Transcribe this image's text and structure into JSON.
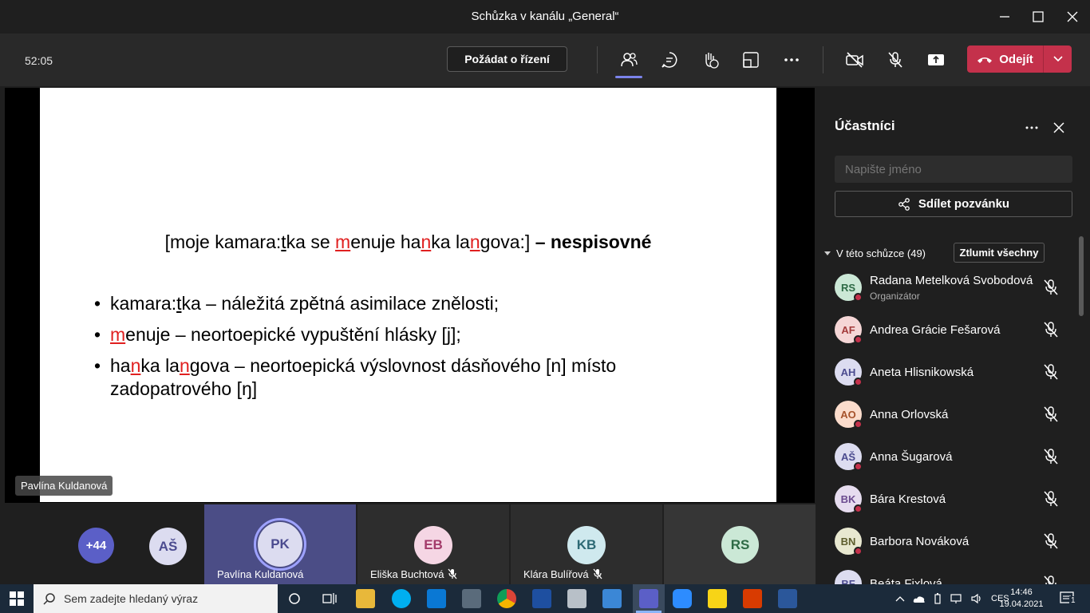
{
  "window": {
    "title": "Schůzka v kanálu „General“"
  },
  "toolbar": {
    "timer": "52:05",
    "request_control_label": "Požádat o řízení",
    "leave_label": "Odejít"
  },
  "slide": {
    "title_part1": "[moje kamara:",
    "title_t": "t",
    "title_part2": "ka se ",
    "title_m": "m",
    "title_part3": "enuje ha",
    "title_n1": "n",
    "title_part4": "ka la",
    "title_n2": "n",
    "title_part5": "gova:] ",
    "title_bold": "– nespisovné",
    "b1_a": "kamara:",
    "b1_t": "t",
    "b1_b": "ka – náležitá zpětná asimilace znělosti;",
    "b2_m": "m",
    "b2_b": "enuje – neortoepické vypuštění hlásky [j];",
    "b3_a": "ha",
    "b3_n1": "n",
    "b3_b": "ka la",
    "b3_n2": "n",
    "b3_c": "gova – neortoepická výslovnost dásňového [n] místo zadopatrového [ŋ]"
  },
  "stage": {
    "presenter_name": "Pavlína Kuldanová"
  },
  "strip": {
    "overflow_count": "+44",
    "tiles": [
      {
        "initials": "AŠ",
        "name": ""
      },
      {
        "initials": "PK",
        "name": "Pavlína Kuldanová"
      },
      {
        "initials": "EB",
        "name": "Eliška Buchtová"
      },
      {
        "initials": "KB",
        "name": "Klára Bulířová"
      },
      {
        "initials": "RS",
        "name": ""
      }
    ]
  },
  "panel": {
    "title": "Účastníci",
    "search_placeholder": "Napište jméno",
    "share_label": "Sdílet pozvánku",
    "section_label": "V této schůzce (49)",
    "mute_all_label": "Ztlumit všechny",
    "participants": [
      {
        "initials": "RS",
        "name": "Radana Metelková Svobodová",
        "role": "Organizátor",
        "color": "#cbe8d6",
        "text": "#2d6a45"
      },
      {
        "initials": "AF",
        "name": "Andrea Grácie Fešarová",
        "role": "",
        "color": "#f5d6d6",
        "text": "#a33b3b"
      },
      {
        "initials": "AH",
        "name": "Aneta Hlisnikowská",
        "role": "",
        "color": "#dcdcf0",
        "text": "#4b4b8f"
      },
      {
        "initials": "AO",
        "name": "Anna Orlovská",
        "role": "",
        "color": "#fbdccc",
        "text": "#a6522b"
      },
      {
        "initials": "AŠ",
        "name": "Anna Šugarová",
        "role": "",
        "color": "#dcdcf0",
        "text": "#4b4b8f"
      },
      {
        "initials": "BK",
        "name": "Bára Krestová",
        "role": "",
        "color": "#e6dcef",
        "text": "#6b4b8f"
      },
      {
        "initials": "BN",
        "name": "Barbora Nováková",
        "role": "",
        "color": "#e8e8d0",
        "text": "#5d5d2d"
      },
      {
        "initials": "BF",
        "name": "Beáta Fixlová",
        "role": "",
        "color": "#dcdcf0",
        "text": "#4b4b8f"
      }
    ]
  },
  "taskbar": {
    "search_placeholder": "Sem zadejte hledaný výraz",
    "lang": "CES",
    "time": "14:46",
    "date": "19.04.2021",
    "notifications": "1"
  }
}
